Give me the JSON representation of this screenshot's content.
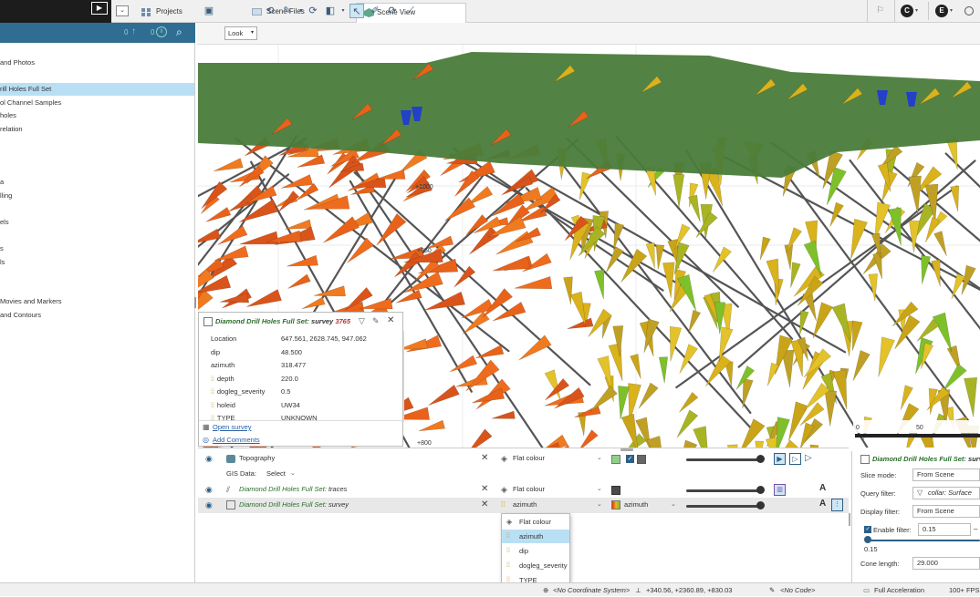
{
  "tabs": [
    {
      "label": "Projects",
      "icon": "projects-icon"
    },
    {
      "label": "Scene Files",
      "icon": "scene-files-icon"
    },
    {
      "label": "Scene View",
      "icon": "scene-view-icon"
    }
  ],
  "left_header": {
    "count1": "0",
    "count2": "0"
  },
  "left_tree": [
    {
      "label": "and Photos",
      "top": 0
    },
    {
      "label": "rill Holes Full Set",
      "selected": true
    },
    {
      "label": "ol Channel Samples"
    },
    {
      "label": "holes"
    },
    {
      "label": "relation"
    },
    {
      "label": "a"
    },
    {
      "label": "lling"
    },
    {
      "label": "els"
    },
    {
      "label": "s"
    },
    {
      "label": "ls"
    },
    {
      "label": "Movies and Markers"
    },
    {
      "label": "and Contours"
    }
  ],
  "toolbar": {
    "look_label": "Look"
  },
  "scene": {
    "axis_labels": [
      "+1000",
      "+950",
      "+800"
    ],
    "scale_labels": [
      "0",
      "50"
    ]
  },
  "info_popup": {
    "title": "Diamond Drill Holes Full Set:",
    "subtitle": "survey",
    "id": "3765",
    "rows": [
      {
        "label": "Location",
        "value": "647.561, 2628.745, 947.062",
        "icon": false
      },
      {
        "label": "dip",
        "value": "48.500",
        "icon": false
      },
      {
        "label": "azimuth",
        "value": "318.477",
        "icon": false
      },
      {
        "label": "depth",
        "value": "220.0",
        "icon": true
      },
      {
        "label": "dogleg_severity",
        "value": "0.5",
        "icon": true
      },
      {
        "label": "holeid",
        "value": "UW34",
        "icon": true
      },
      {
        "label": "TYPE",
        "value": "UNKNOWN",
        "icon": true
      }
    ],
    "open_link": "Open survey",
    "add_comments": "Add Comments"
  },
  "layers": [
    {
      "name": "Topography",
      "colour_mode": "Flat colour",
      "italic": false
    },
    {
      "name": "Diamond Drill Holes Full Set: traces",
      "prefix": "Diamond Drill Holes Full Set:",
      "suffix": " traces",
      "colour_mode": "Flat colour",
      "italic": true
    },
    {
      "name": "Diamond Drill Holes Full Set: survey",
      "prefix": "Diamond Drill Holes Full Set:",
      "suffix": " survey",
      "colour_mode": "azimuth",
      "legend_label": "azimuth",
      "italic": true
    }
  ],
  "gis": {
    "label": "GIS Data:",
    "value": "Select"
  },
  "dropdown_items": [
    "Flat colour",
    "azimuth",
    "dip",
    "dogleg_severity",
    "TYPE"
  ],
  "props": {
    "title_prefix": "Diamond Drill Holes Full Set:",
    "title_suffix": " survey",
    "slice_mode_label": "Slice mode:",
    "slice_mode_value": "From Scene",
    "query_filter_label": "Query filter:",
    "query_filter_value": "collar: Surface",
    "display_filter_label": "Display filter:",
    "display_filter_value": "From Scene",
    "enable_filter_label": "Enable filter:",
    "enable_filter_value": "0.15",
    "slider_value": "0.15",
    "cone_length_label": "Cone length:",
    "cone_length_value": "29.000"
  },
  "status": {
    "coord_system": "<No Coordinate System>",
    "coords": "+340.56, +2360.89, +830.03",
    "code": "<No Code>",
    "accel": "Full Acceleration",
    "fps": "100+ FPS"
  },
  "colors": {
    "accent": "#2f6e92",
    "selection": "#b9dff4",
    "topo_green": "#4a7c3a",
    "cone_orange": "#e8621a",
    "cone_yellow": "#d9b21c"
  }
}
